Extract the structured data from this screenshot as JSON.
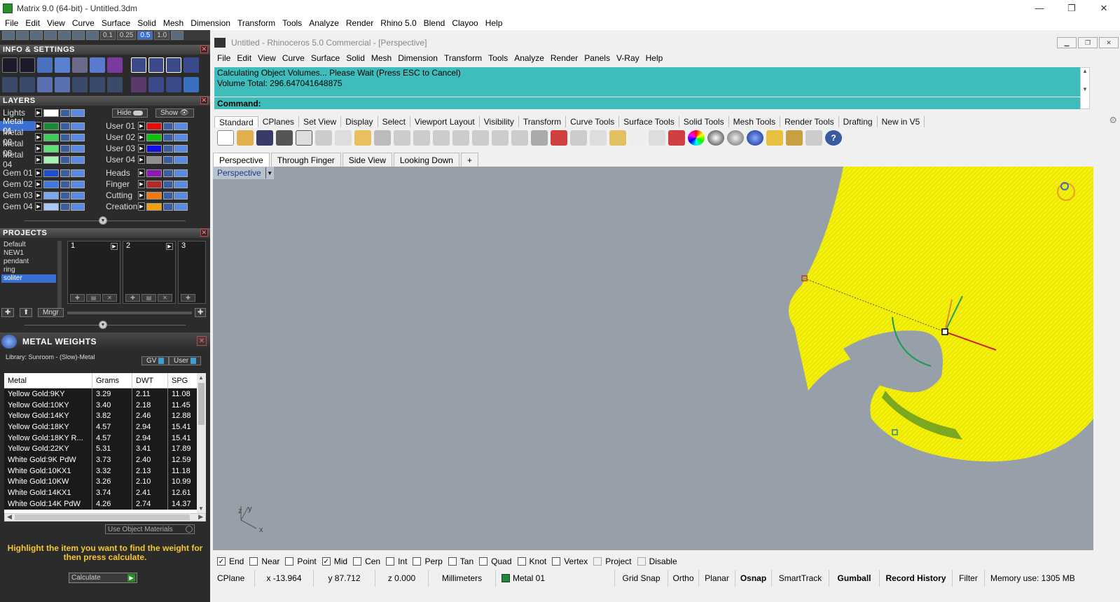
{
  "app": {
    "title": "Matrix 9.0 (64-bit) - Untitled.3dm",
    "window_buttons": [
      "—",
      "❐",
      "✕"
    ]
  },
  "menu": [
    "File",
    "Edit",
    "View",
    "Curve",
    "Surface",
    "Solid",
    "Mesh",
    "Dimension",
    "Transform",
    "Tools",
    "Analyze",
    "Render",
    "Rhino 5.0",
    "Blend",
    "Clayoo",
    "Help"
  ],
  "quick_toolbar": {
    "values": [
      "0.1",
      "0.25",
      "0.5",
      "1.0"
    ]
  },
  "info_settings": {
    "title": "INFO & SETTINGS"
  },
  "layers": {
    "title": "LAYERS",
    "lights_label": "Lights",
    "hide_label": "Hide",
    "show_label": "Show",
    "left": [
      {
        "name": "Metal 01",
        "color": "#1a8a3a",
        "selected": true
      },
      {
        "name": "Metal 02",
        "color": "#3ecb5a"
      },
      {
        "name": "Metal 03",
        "color": "#5fe07a"
      },
      {
        "name": "Metal 04",
        "color": "#a6f2b0"
      },
      {
        "name": "Gem 01",
        "color": "#1f4fd0"
      },
      {
        "name": "Gem 02",
        "color": "#3f78e0"
      },
      {
        "name": "Gem 03",
        "color": "#7aa8f0"
      },
      {
        "name": "Gem 04",
        "color": "#a9c8f8"
      }
    ],
    "right": [
      {
        "name": "User 01",
        "color": "#e01010"
      },
      {
        "name": "User 02",
        "color": "#10c010"
      },
      {
        "name": "User 03",
        "color": "#1010e0"
      },
      {
        "name": "User 04",
        "color": "#909090"
      },
      {
        "name": "Heads",
        "color": "#8a1ab0"
      },
      {
        "name": "Finger",
        "color": "#b02a2a"
      },
      {
        "name": "Cutting",
        "color": "#f07a10"
      },
      {
        "name": "Creation",
        "color": "#f0a010"
      }
    ]
  },
  "projects": {
    "title": "PROJECTS",
    "list": [
      "Default",
      "NEW1",
      "pendant",
      "ring",
      "soliter"
    ],
    "selected": "soliter",
    "boxes": [
      "1",
      "2",
      "3"
    ],
    "mngr_label": "Mngr"
  },
  "metal_weights": {
    "title": "METAL WEIGHTS",
    "library": "Library: Sunroom - (Slow)-Metal",
    "gv_label": "GV",
    "user_label": "User",
    "headers": [
      "Metal",
      "Grams",
      "DWT",
      "SPG"
    ],
    "rows": [
      [
        "Yellow Gold:9KY",
        "3.29",
        "2.11",
        "11.08"
      ],
      [
        "Yellow Gold:10KY",
        "3.40",
        "2.18",
        "11.45"
      ],
      [
        "Yellow Gold:14KY",
        "3.82",
        "2.46",
        "12.88"
      ],
      [
        "Yellow Gold:18KY",
        "4.57",
        "2.94",
        "15.41"
      ],
      [
        "Yellow Gold:18KY R...",
        "4.57",
        "2.94",
        "15.41"
      ],
      [
        "Yellow Gold:22KY",
        "5.31",
        "3.41",
        "17.89"
      ],
      [
        "White Gold:9K PdW",
        "3.73",
        "2.40",
        "12.59"
      ],
      [
        "White Gold:10KX1",
        "3.32",
        "2.13",
        "11.18"
      ],
      [
        "White Gold:10KW",
        "3.26",
        "2.10",
        "10.99"
      ],
      [
        "White Gold:14KX1",
        "3.74",
        "2.41",
        "12.61"
      ],
      [
        "White Gold:14K PdW",
        "4.26",
        "2.74",
        "14.37"
      ]
    ],
    "use_object_materials": "Use Object Materials",
    "hint": "Highlight the item you want to find the weight for then press calculate.",
    "calculate_label": "Calculate"
  },
  "rhino": {
    "title": "Untitled - Rhinoceros 5.0 Commercial - [Perspective]",
    "menu": [
      "File",
      "Edit",
      "View",
      "Curve",
      "Surface",
      "Solid",
      "Mesh",
      "Dimension",
      "Transform",
      "Tools",
      "Analyze",
      "Render",
      "Panels",
      "V-Ray",
      "Help"
    ],
    "command_lines": [
      "Calculating Object Volumes... Please Wait (Press ESC to Cancel)",
      "Volume Total: 296.647041648875"
    ],
    "command_prompt": "Command:",
    "toolbar_tabs": [
      "Standard",
      "CPlanes",
      "Set View",
      "Display",
      "Select",
      "Viewport Layout",
      "Visibility",
      "Transform",
      "Curve Tools",
      "Surface Tools",
      "Solid Tools",
      "Mesh Tools",
      "Render Tools",
      "Drafting",
      "New in V5"
    ],
    "active_toolbar_tab": "Standard",
    "view_tabs": [
      "Perspective",
      "Through Finger",
      "Side View",
      "Looking Down"
    ],
    "add_view_symbol": "+",
    "viewport_label": "Perspective",
    "axis_labels": {
      "x": "x",
      "y": "y",
      "z": "z"
    },
    "osnaps": [
      {
        "label": "End",
        "checked": true
      },
      {
        "label": "Near",
        "checked": false
      },
      {
        "label": "Point",
        "checked": false
      },
      {
        "label": "Mid",
        "checked": true
      },
      {
        "label": "Cen",
        "checked": false
      },
      {
        "label": "Int",
        "checked": false
      },
      {
        "label": "Perp",
        "checked": false
      },
      {
        "label": "Tan",
        "checked": false
      },
      {
        "label": "Quad",
        "checked": false
      },
      {
        "label": "Knot",
        "checked": false
      },
      {
        "label": "Vertex",
        "checked": false
      },
      {
        "label": "Project",
        "checked": false,
        "disabled": true
      },
      {
        "label": "Disable",
        "checked": false,
        "disabled": true
      }
    ],
    "status": {
      "cplane": "CPlane",
      "x": "x -13.964",
      "y": "y 87.712",
      "z": "z 0.000",
      "units": "Millimeters",
      "layer": "Metal 01",
      "layer_color": "#1a8a3a",
      "buttons": [
        "Grid Snap",
        "Ortho",
        "Planar",
        "Osnap",
        "SmartTrack",
        "Gumball",
        "Record History",
        "Filter"
      ],
      "bold_buttons": [
        "Osnap",
        "Gumball",
        "Record History"
      ],
      "memory": "Memory use: 1305 MB"
    }
  }
}
